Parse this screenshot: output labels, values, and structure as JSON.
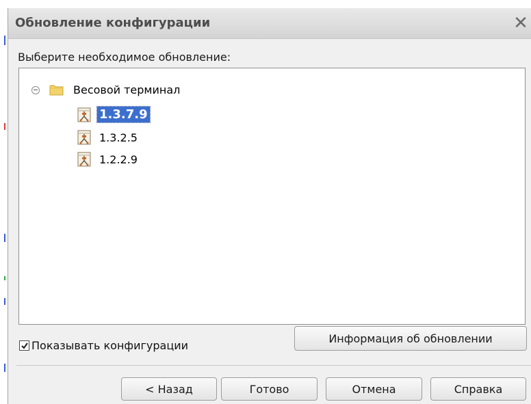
{
  "dialog": {
    "title": "Обновление конфигурации",
    "close_symbol": "✕"
  },
  "prompt": "Выберите необходимое обновление:",
  "tree": {
    "root": {
      "label": "Весовой терминал",
      "icon": "folder-icon",
      "expanded": true
    },
    "versions": [
      {
        "label": "1.3.7.9",
        "selected": true,
        "icon": "configuration-icon"
      },
      {
        "label": "1.3.2.5",
        "selected": false,
        "icon": "configuration-icon"
      },
      {
        "label": "1.2.2.9",
        "selected": false,
        "icon": "configuration-icon"
      }
    ]
  },
  "show_configs": {
    "label": "Показывать конфигурации",
    "checked": true
  },
  "buttons": {
    "update_info": "Информация об обновлении",
    "back": "< Назад",
    "finish": "Готово",
    "cancel": "Отмена",
    "help": "Справка"
  },
  "colors": {
    "selection": "#3c6fcd",
    "folder": "#f3d36b"
  }
}
